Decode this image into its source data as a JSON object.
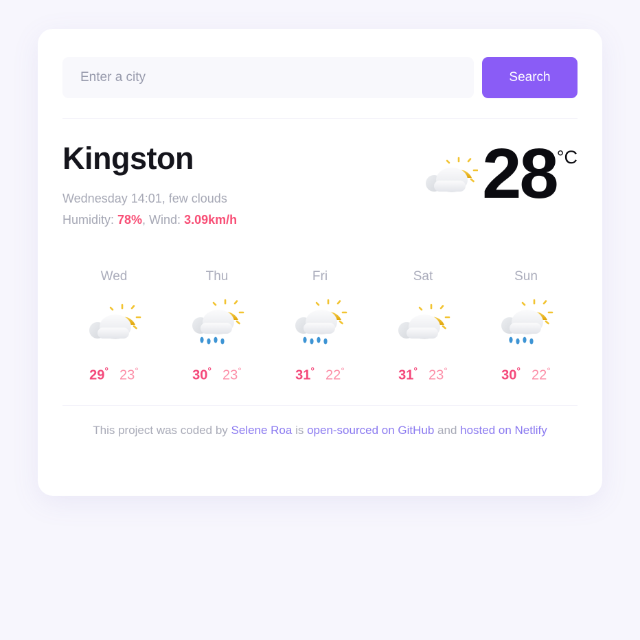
{
  "search": {
    "placeholder": "Enter a city",
    "value": "",
    "button_label": "Search"
  },
  "current": {
    "city": "Kingston",
    "conditions": "Wednesday 14:01, few clouds",
    "humidity_label": "Humidity: ",
    "humidity_value": "78%",
    "wind_separator": ", Wind: ",
    "wind_value": "3.09km/h",
    "temperature": "28",
    "unit": "°C",
    "icon": "sun-behind-cloud-icon"
  },
  "forecast": [
    {
      "day": "Wed",
      "icon": "sun-behind-cloud-icon",
      "max": "29",
      "min": "23",
      "deg": "°"
    },
    {
      "day": "Thu",
      "icon": "sun-behind-rain-cloud-icon",
      "max": "30",
      "min": "23",
      "deg": "°"
    },
    {
      "day": "Fri",
      "icon": "sun-behind-rain-cloud-icon",
      "max": "31",
      "min": "22",
      "deg": "°"
    },
    {
      "day": "Sat",
      "icon": "sun-behind-cloud-icon",
      "max": "31",
      "min": "23",
      "deg": "°"
    },
    {
      "day": "Sun",
      "icon": "sun-behind-rain-cloud-icon",
      "max": "30",
      "min": "22",
      "deg": "°"
    }
  ],
  "footer": {
    "prefix": "This project was coded by ",
    "author": "Selene Roa",
    "mid1": " is ",
    "source_link": "open-sourced on GitHub",
    "mid2": " and ",
    "host_link": "hosted on Netlify"
  },
  "colors": {
    "page_background": "#f7f6fd",
    "card_background": "#ffffff",
    "accent_purple": "#8a5cf6",
    "accent_pink": "#f4487a",
    "accent_pink_light": "#fc8fa8",
    "muted_text": "#a8aab7",
    "sun_yellow": "#edb521",
    "rain_blue": "#3d94d4"
  }
}
